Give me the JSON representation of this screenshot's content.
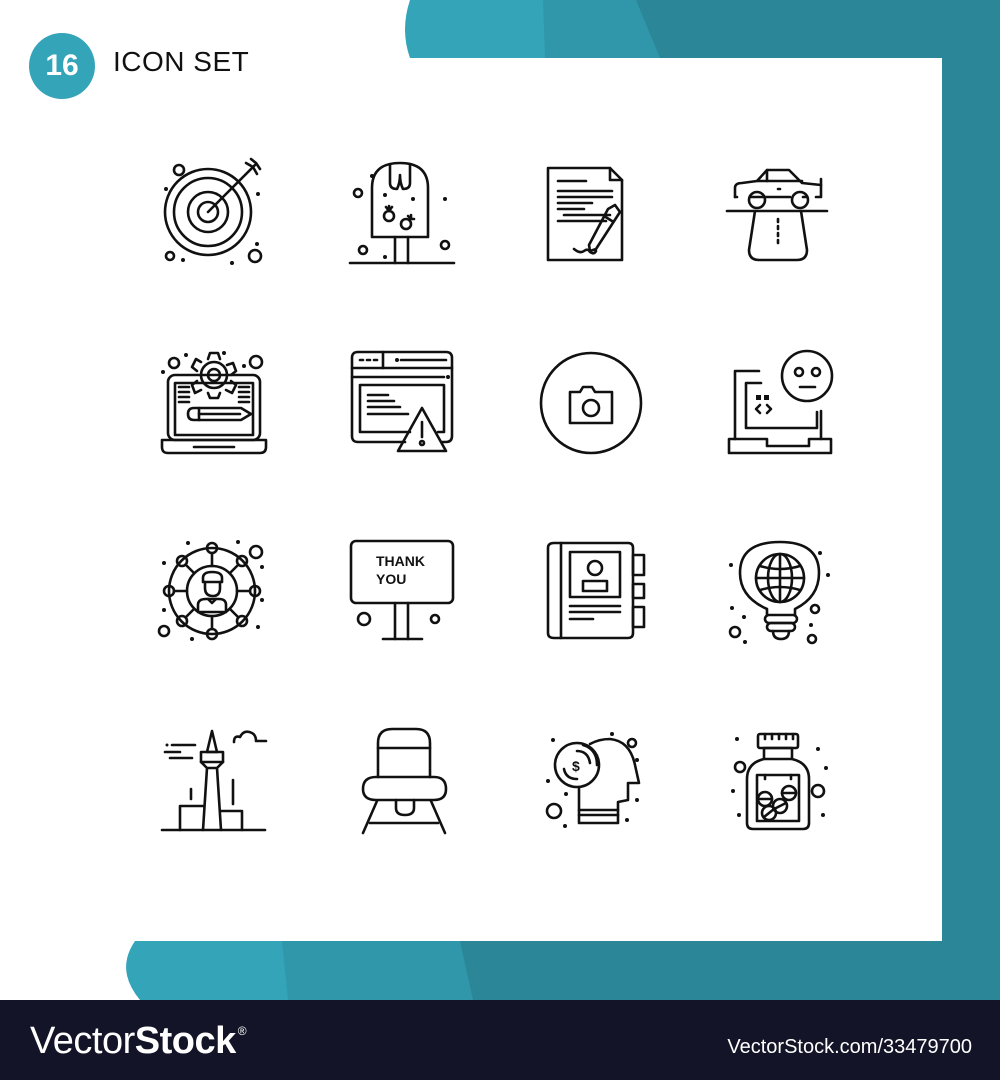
{
  "header": {
    "count_badge": "16",
    "title": "ICON SET"
  },
  "colors": {
    "teal_light": "#34a4b9",
    "teal_mid": "#3097aa",
    "teal_dark": "#2b8797",
    "footer_bg": "#131427"
  },
  "icons": [
    {
      "name": "target-icon"
    },
    {
      "name": "popsicle-icon"
    },
    {
      "name": "contract-signing-icon"
    },
    {
      "name": "car-road-icon"
    },
    {
      "name": "laptop-settings-icon"
    },
    {
      "name": "browser-warning-icon"
    },
    {
      "name": "camera-circle-icon"
    },
    {
      "name": "laptop-emoji-icon"
    },
    {
      "name": "user-network-icon"
    },
    {
      "name": "thank-you-signboard-icon",
      "text_line1": "THANK",
      "text_line2": "YOU"
    },
    {
      "name": "contact-book-icon"
    },
    {
      "name": "globe-bulb-icon"
    },
    {
      "name": "tower-landmark-icon"
    },
    {
      "name": "chair-icon"
    },
    {
      "name": "money-mind-icon"
    },
    {
      "name": "pill-jar-icon"
    }
  ],
  "footer": {
    "logo_thin": "Vector",
    "logo_bold": "Stock",
    "logo_mark": "®",
    "url": "VectorStock.com/33479700"
  }
}
